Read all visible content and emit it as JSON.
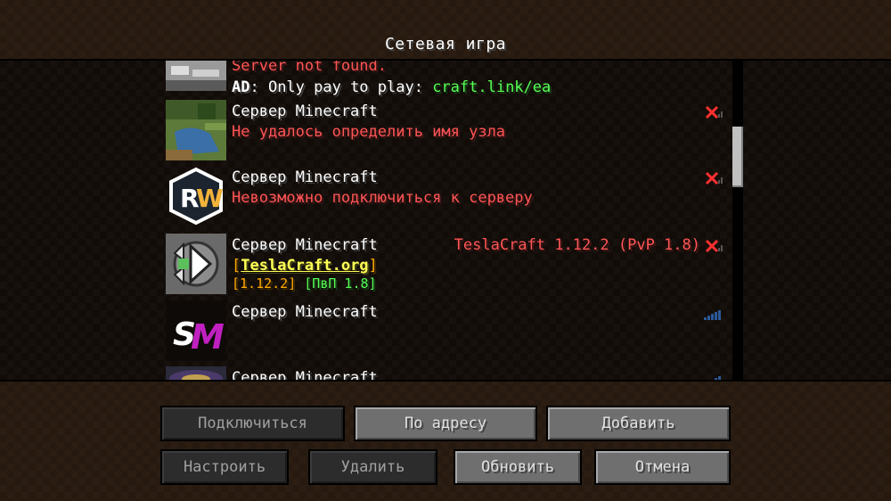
{
  "title": "Сетевая игра",
  "servers": [
    {
      "line1": "Server not found.",
      "ad_prefix": "AD",
      "ad_text": ": Only pay to play: ",
      "ad_link": "craft.link/ea"
    },
    {
      "name": "Сервер Minecraft",
      "motd": "Не удалось определить имя узла",
      "status_icon": "x-icon"
    },
    {
      "name": "Сервер Minecraft",
      "motd": "Невозможно подключиться к серверу",
      "status_icon": "x-icon"
    },
    {
      "name": "Сервер Minecraft",
      "version": "TeslaCraft 1.12.2 (PvP 1.8)",
      "motd_bracket_open": "[",
      "motd_site": "TeslaCraft.org",
      "motd_bracket_close": "]",
      "tag1": "[1.12.2]",
      "tag2": "[ПвП 1.8]",
      "status_icon": "x-icon"
    },
    {
      "name": "Сервер Minecraft",
      "status_icon": "signal-icon"
    },
    {
      "name": "Сервер Minecraft",
      "status_icon": "signal-icon"
    }
  ],
  "buttons": {
    "connect": "Подключиться",
    "direct": "По адресу",
    "add": "Добавить",
    "edit": "Настроить",
    "delete": "Удалить",
    "refresh": "Обновить",
    "cancel": "Отмена"
  },
  "colors": {
    "error": "#ff5555",
    "gold": "#ffaa00",
    "yellow": "#ffff55",
    "green": "#55ff55",
    "aqua": "#55ffff"
  }
}
